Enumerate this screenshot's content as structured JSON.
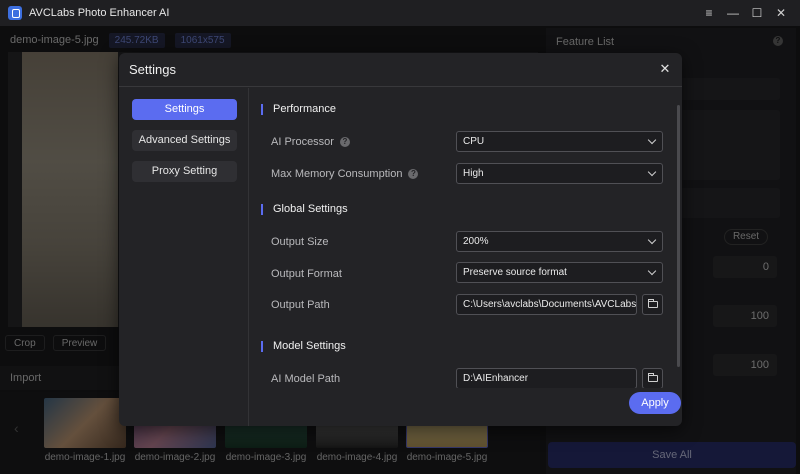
{
  "app": {
    "title": "AVCLabs Photo Enhancer AI"
  },
  "window_controls": {
    "menu": "≡",
    "minimize": "—",
    "maximize": "☐",
    "close": "✕"
  },
  "image_info": {
    "name": "demo-image-5.jpg",
    "size": "245.72KB",
    "resolution": "1061x575"
  },
  "preview_tools": {
    "crop": "Crop",
    "preview": "Preview"
  },
  "import": {
    "label": "Import"
  },
  "thumbnails": [
    {
      "label": "demo-image-1.jpg"
    },
    {
      "label": "demo-image-2.jpg"
    },
    {
      "label": "demo-image-3.jpg"
    },
    {
      "label": "demo-image-4.jpg"
    },
    {
      "label": "demo-image-5.jpg"
    }
  ],
  "right_panel": {
    "title": "Feature List",
    "reset": "Reset",
    "field1": "0",
    "field2": "100",
    "field3": "100",
    "save_all": "Save All"
  },
  "dialog": {
    "title": "Settings",
    "nav": [
      {
        "label": "Settings",
        "active": true
      },
      {
        "label": "Advanced Settings",
        "active": false
      },
      {
        "label": "Proxy Setting",
        "active": false
      }
    ],
    "sections": {
      "performance": "Performance",
      "global": "Global Settings",
      "model": "Model Settings"
    },
    "rows": {
      "ai_processor": {
        "label": "AI Processor",
        "value": "CPU"
      },
      "max_memory": {
        "label": "Max Memory Consumption",
        "value": "High"
      },
      "output_size": {
        "label": "Output Size",
        "value": "200%"
      },
      "output_format": {
        "label": "Output Format",
        "value": "Preserve source format"
      },
      "output_path": {
        "label": "Output Path",
        "value": "C:\\Users\\avclabs\\Documents\\AVCLabs"
      },
      "ai_model_path": {
        "label": "AI Model Path",
        "value": "D:\\AIEnhancer"
      }
    },
    "apply": "Apply"
  },
  "colors": {
    "accent": "#5b6cf0",
    "background": "#1b1b1d",
    "dialog": "#232326"
  }
}
